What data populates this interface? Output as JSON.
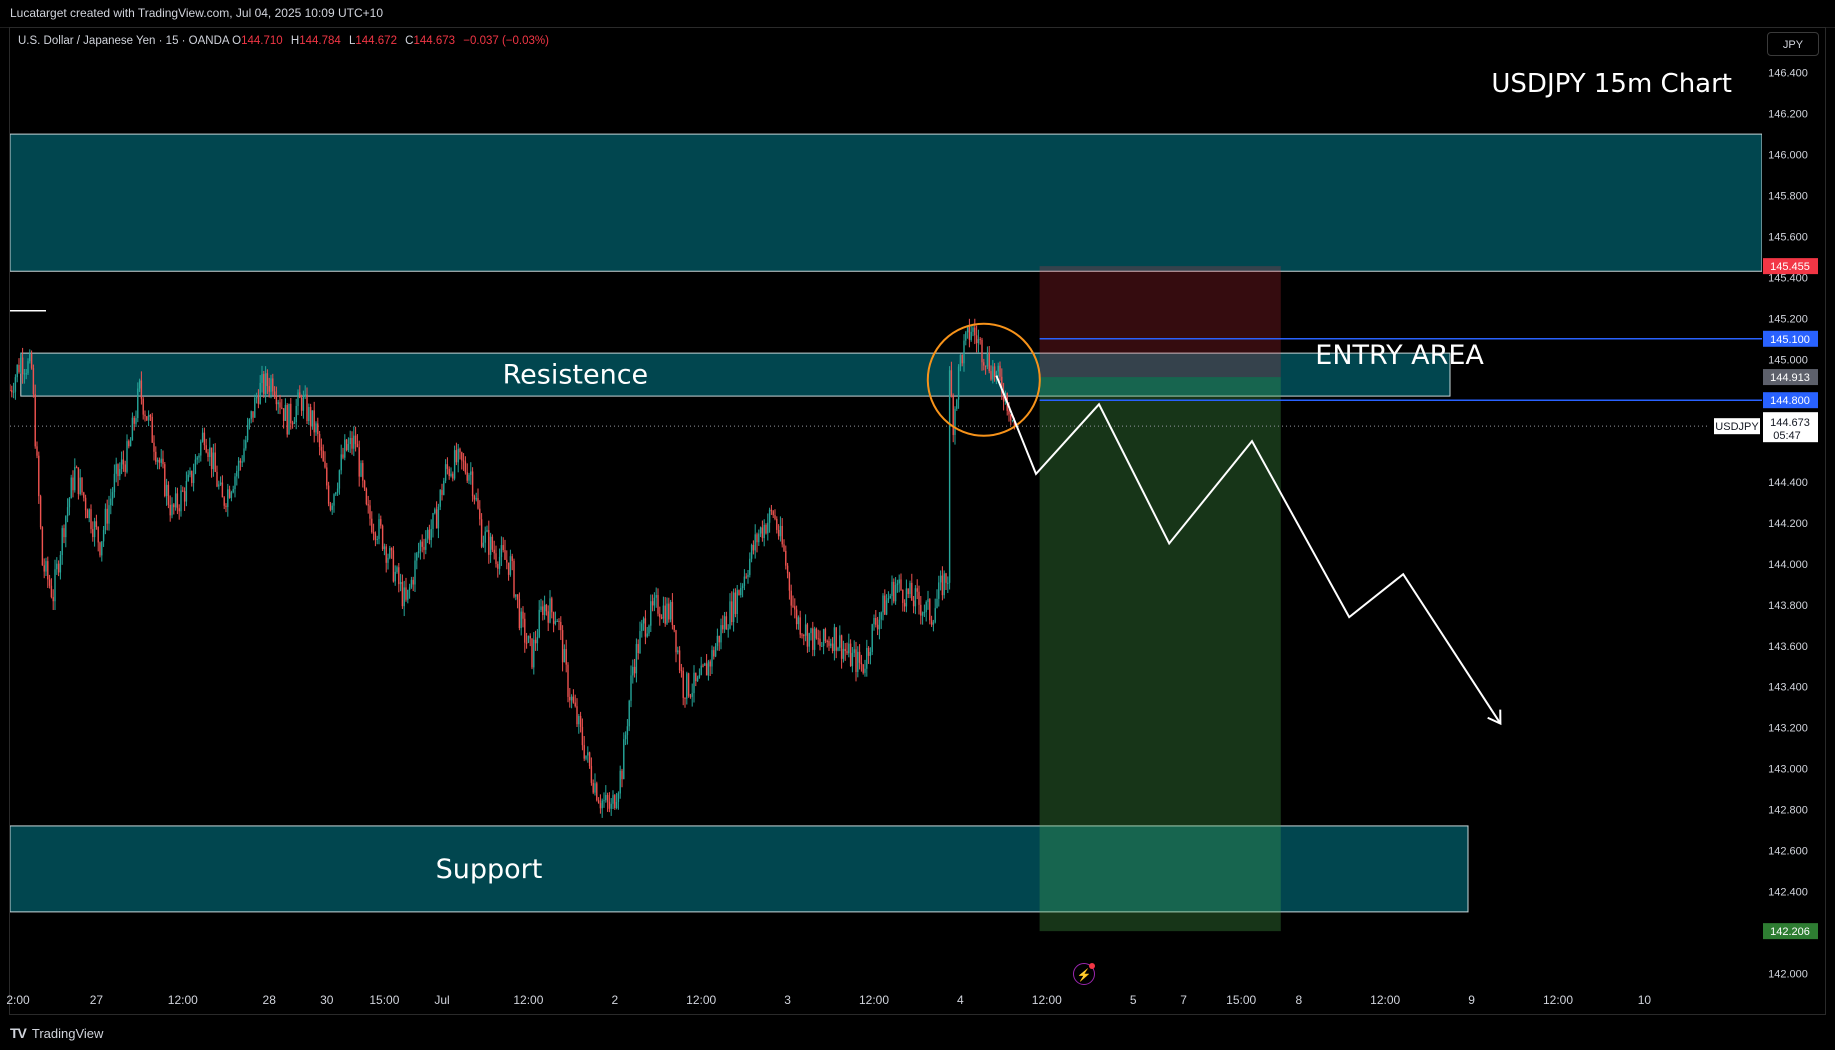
{
  "header": {
    "attribution": "Lucatarget created with TradingView.com, Jul 04, 2025 10:09 UTC+10"
  },
  "legend": {
    "symbol": "U.S. Dollar / Japanese Yen · 15 · OANDA",
    "open_label": "O",
    "open": "144.710",
    "high_label": "H",
    "high": "144.784",
    "low_label": "L",
    "low": "144.672",
    "close_label": "C",
    "close": "144.673",
    "change": "−0.037 (−0.03%)"
  },
  "currency_button": "JPY",
  "footer": {
    "brand": "TradingView",
    "logo": "TV"
  },
  "colors": {
    "zone": "#01464f",
    "zone_border": "#c9d7da",
    "up": "#26a69a",
    "down": "#ef5350",
    "stop": "#f23645",
    "target": "#2e7d32",
    "entry_line": "#2962ff",
    "circle": "#f7931a"
  },
  "chart_data": {
    "type": "candlestick",
    "title": "USDJPY 15m Chart",
    "symbol": "USDJPY",
    "timeframe": "15",
    "ylim": [
      141.85,
      146.55
    ],
    "yticks": [
      142.0,
      142.2,
      142.4,
      142.6,
      142.8,
      143.0,
      143.2,
      143.4,
      143.6,
      143.8,
      144.0,
      144.2,
      144.4,
      144.6,
      144.8,
      145.0,
      145.2,
      145.4,
      145.6,
      145.8,
      146.0,
      146.2,
      146.4
    ],
    "ytick_labels": [
      "142.000",
      "142.200",
      "142.400",
      "142.600",
      "142.800",
      "143.000",
      "143.200",
      "143.400",
      "143.600",
      "143.800",
      "144.000",
      "144.200",
      "144.400",
      "",
      "",
      "145.000",
      "145.200",
      "145.400",
      "145.600",
      "145.800",
      "146.000",
      "146.200",
      "146.400"
    ],
    "xaxis_labels": [
      "2:00",
      "27",
      "12:00",
      "28",
      "30",
      "15:00",
      "Jul",
      "12:00",
      "2",
      "12:00",
      "3",
      "12:00",
      "4",
      "12:00",
      "5",
      "7",
      "15:00",
      "8",
      "12:00",
      "9",
      "12:00",
      "10"
    ],
    "xaxis_index": [
      0,
      48,
      96,
      144,
      176,
      208,
      240,
      288,
      336,
      384,
      432,
      480,
      528,
      576,
      624,
      652,
      684,
      716,
      764,
      812,
      860,
      908
    ],
    "price_path": [
      [
        0,
        144.85
      ],
      [
        6,
        145.0
      ],
      [
        12,
        144.95
      ],
      [
        18,
        144.0
      ],
      [
        24,
        143.85
      ],
      [
        30,
        144.2
      ],
      [
        36,
        144.45
      ],
      [
        44,
        144.25
      ],
      [
        50,
        144.1
      ],
      [
        58,
        144.4
      ],
      [
        66,
        144.55
      ],
      [
        72,
        144.85
      ],
      [
        80,
        144.6
      ],
      [
        90,
        144.25
      ],
      [
        100,
        144.4
      ],
      [
        108,
        144.65
      ],
      [
        118,
        144.3
      ],
      [
        128,
        144.5
      ],
      [
        138,
        144.85
      ],
      [
        146,
        144.9
      ],
      [
        154,
        144.7
      ],
      [
        162,
        144.8
      ],
      [
        170,
        144.65
      ],
      [
        178,
        144.3
      ],
      [
        186,
        144.55
      ],
      [
        192,
        144.6
      ],
      [
        198,
        144.25
      ],
      [
        206,
        144.15
      ],
      [
        214,
        143.95
      ],
      [
        220,
        143.8
      ],
      [
        228,
        144.1
      ],
      [
        236,
        144.2
      ],
      [
        242,
        144.45
      ],
      [
        248,
        144.5
      ],
      [
        256,
        144.45
      ],
      [
        262,
        144.15
      ],
      [
        270,
        144.05
      ],
      [
        278,
        144.0
      ],
      [
        284,
        143.7
      ],
      [
        290,
        143.55
      ],
      [
        296,
        143.8
      ],
      [
        304,
        143.75
      ],
      [
        310,
        143.4
      ],
      [
        316,
        143.2
      ],
      [
        322,
        143.0
      ],
      [
        328,
        142.85
      ],
      [
        334,
        142.8
      ],
      [
        340,
        143.0
      ],
      [
        346,
        143.5
      ],
      [
        352,
        143.7
      ],
      [
        360,
        143.8
      ],
      [
        368,
        143.75
      ],
      [
        374,
        143.4
      ],
      [
        382,
        143.4
      ],
      [
        390,
        143.55
      ],
      [
        396,
        143.7
      ],
      [
        402,
        143.8
      ],
      [
        408,
        143.95
      ],
      [
        416,
        144.15
      ],
      [
        424,
        144.25
      ],
      [
        430,
        144.05
      ],
      [
        436,
        143.75
      ],
      [
        444,
        143.65
      ],
      [
        450,
        143.6
      ],
      [
        458,
        143.65
      ],
      [
        466,
        143.55
      ],
      [
        474,
        143.5
      ],
      [
        480,
        143.7
      ],
      [
        486,
        143.8
      ],
      [
        492,
        143.9
      ],
      [
        498,
        143.85
      ],
      [
        506,
        143.8
      ],
      [
        512,
        143.75
      ],
      [
        518,
        143.9
      ],
      [
        521,
        143.95
      ],
      [
        522,
        144.9
      ],
      [
        524,
        144.7
      ],
      [
        528,
        145.0
      ],
      [
        534,
        145.15
      ],
      [
        540,
        145.05
      ],
      [
        546,
        144.95
      ],
      [
        552,
        144.85
      ],
      [
        556,
        144.75
      ],
      [
        558,
        144.67
      ]
    ],
    "current_price": 144.673,
    "countdown": "05:47",
    "zones": [
      {
        "name": "supply-zone",
        "label": "",
        "low": 145.43,
        "high": 146.1,
        "x_from": 0,
        "x_to": 880
      },
      {
        "name": "resistance-zone",
        "label": "Resistence",
        "low": 144.82,
        "high": 145.03,
        "x_from": 6,
        "x_to": 800
      },
      {
        "name": "support-zone",
        "label": "Support",
        "low": 142.3,
        "high": 142.72,
        "x_from": 0,
        "x_to": 810
      }
    ],
    "position": {
      "type": "short",
      "entry": 144.913,
      "stop": 145.455,
      "target": 142.206,
      "x_from": 572,
      "x_to": 706
    },
    "horizontal_lines": [
      {
        "name": "entry-upper-line",
        "price": 145.1,
        "label": "145.100",
        "x_from": 572
      },
      {
        "name": "entry-lower-line",
        "price": 144.8,
        "label": "144.800",
        "x_from": 572
      }
    ],
    "price_labels": [
      {
        "name": "stop-price-label",
        "price": 145.455,
        "text": "145.455",
        "color": "#f23645"
      },
      {
        "name": "entry-upper-price-label",
        "price": 145.1,
        "text": "145.100",
        "color": "#2962ff"
      },
      {
        "name": "entry-price-label",
        "price": 144.913,
        "text": "144.913",
        "color": "#5d606b"
      },
      {
        "name": "entry-lower-price-label",
        "price": 144.8,
        "text": "144.800",
        "color": "#2962ff"
      },
      {
        "name": "target-price-label",
        "price": 142.206,
        "text": "142.206",
        "color": "#2e7d32"
      }
    ],
    "projection": [
      [
        548,
        144.92
      ],
      [
        570,
        144.44
      ],
      [
        605,
        144.78
      ],
      [
        644,
        144.1
      ],
      [
        690,
        144.6
      ],
      [
        744,
        143.74
      ],
      [
        774,
        143.95
      ],
      [
        828,
        143.22
      ]
    ],
    "annotations": [
      {
        "name": "entry-area-label",
        "text": "ENTRY AREA",
        "x": 772,
        "price": 145.02
      },
      {
        "name": "highlight-circle",
        "x": 541,
        "price": 144.9
      }
    ],
    "legend_short_line": {
      "price": 145.1
    }
  }
}
